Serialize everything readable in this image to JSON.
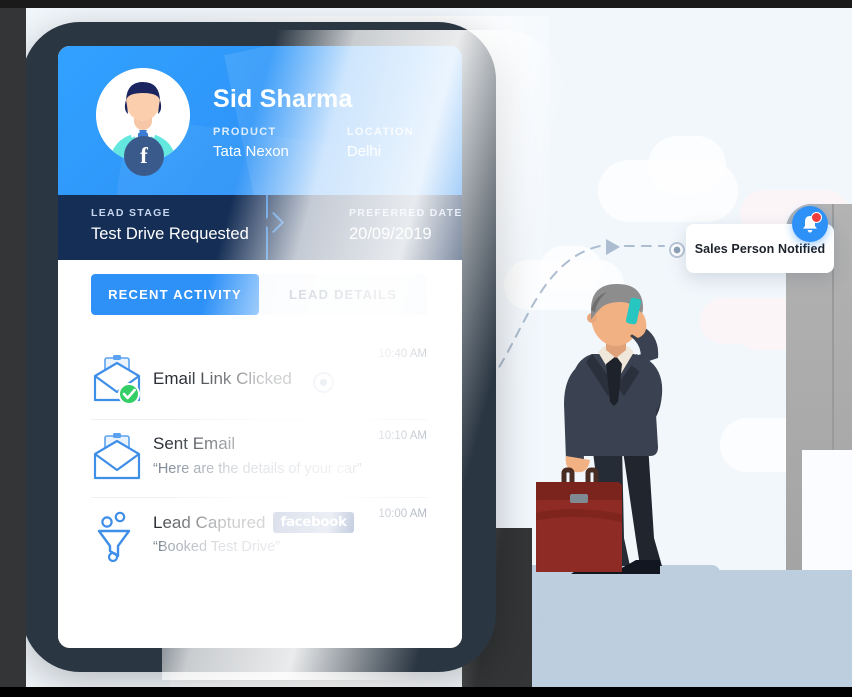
{
  "device": {
    "frame_color": "#2a3642",
    "accent_blue": "#2e91f8",
    "dark_navy": "#152e55"
  },
  "card": {
    "hero": {
      "name": "Sid Sharma",
      "avatar_name": "user-avatar",
      "social_badge": "f",
      "fields": [
        {
          "key": "PRODUCT",
          "value": "Tata Nexon"
        },
        {
          "key": "LOCATION",
          "value": "Delhi"
        }
      ]
    },
    "stage_bar": [
      {
        "key": "LEAD STAGE",
        "value": "Test Drive Requested"
      },
      {
        "key": "PREFERRED DATE",
        "value": "20/09/2019"
      }
    ],
    "tabs": [
      {
        "label": "RECENT ACTIVITY",
        "active": true
      },
      {
        "label": "LEAD DETAILS",
        "active": false
      }
    ],
    "activity": [
      {
        "icon": "email-opened-check-icon",
        "title": "Email Link Clicked",
        "subtitle": "",
        "time": "10:40 AM",
        "badge": "",
        "has_node": true
      },
      {
        "icon": "email-icon",
        "title": "Sent Email",
        "subtitle": "“Here are the details of your car”",
        "time": "10:10 AM",
        "badge": "",
        "has_node": false
      },
      {
        "icon": "funnel-icon",
        "title": "Lead Captured",
        "subtitle": "“Booked Test Drive”",
        "time": "10:00 AM",
        "badge": "facebook",
        "has_node": false
      }
    ]
  },
  "notification": {
    "text": "Sales Person Notified",
    "icon": "bell-icon",
    "has_unread_dot": true,
    "accent": "#2e91f8",
    "dot_color": "#f03c3c"
  },
  "illustration": {
    "character": "businessman-on-phone-with-briefcase",
    "suit_color": "#3a4150",
    "briefcase_color": "#8e2b24",
    "skin_color": "#f2b183",
    "hair_color": "#8d8d8d",
    "phone_color": "#27c6c0"
  },
  "scene": {
    "background": "#f2f7fc",
    "floor_color": "#bdcede",
    "clouds": 4,
    "right_device": "tablet-frame"
  },
  "connector": {
    "style": "dashed-curve",
    "color": "#adbdd1",
    "has_arrow": true
  }
}
